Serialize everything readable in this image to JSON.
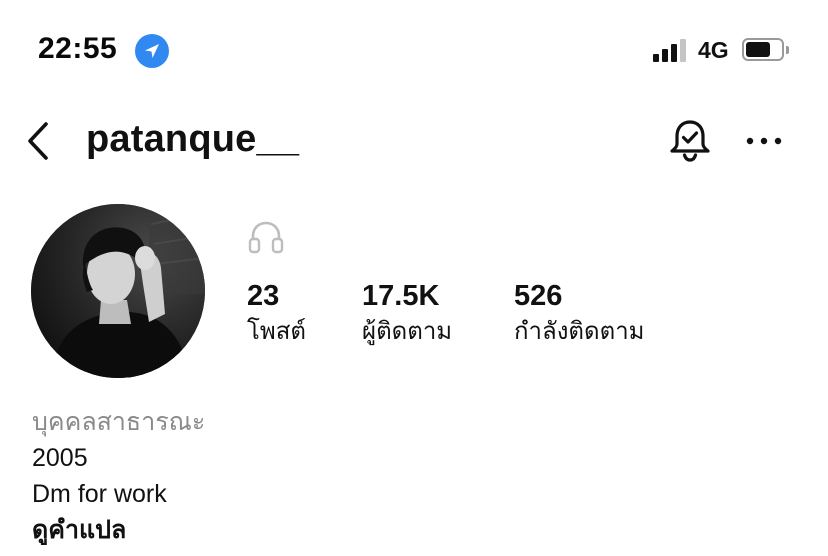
{
  "status_bar": {
    "time": "22:55",
    "location_icon": "location-arrow-icon",
    "signal_icon": "cellular-signal-icon",
    "signal_bars_filled": 3,
    "signal_bars_total": 4,
    "network": "4G",
    "battery_icon": "battery-icon",
    "battery_level": 0.7,
    "accent_color": "#2f89f0"
  },
  "header": {
    "back_icon": "chevron-left-icon",
    "username": "patanque__",
    "bell_icon": "notification-bell-check-icon",
    "more_icon": "ellipsis-icon"
  },
  "profile": {
    "avatar_icon": "profile-photo",
    "headphones_icon": "headphones-icon",
    "stats": [
      {
        "count": "23",
        "label": "โพสต์"
      },
      {
        "count": "17.5K",
        "label": "ผู้ติดตาม"
      },
      {
        "count": "526",
        "label": "กำลังติดตาม"
      }
    ],
    "bio": {
      "category": "บุคคลสาธารณะ",
      "line1": "2005",
      "line2": "Dm for work",
      "translate": "ดูคำแปล"
    }
  }
}
